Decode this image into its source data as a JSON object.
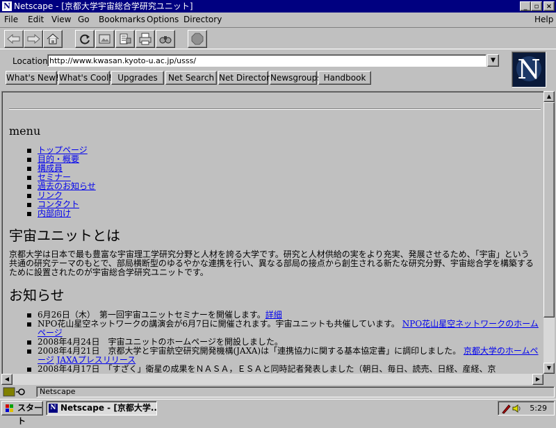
{
  "window": {
    "title": "Netscape - [京都大学宇宙総合学研究ユニット]",
    "app_icon": "N",
    "minimize": "_",
    "maximize": "▫",
    "close": "×"
  },
  "menubar": {
    "items": [
      {
        "label": "File",
        "key": "F"
      },
      {
        "label": "Edit",
        "key": "E"
      },
      {
        "label": "View",
        "key": "V"
      },
      {
        "label": "Go",
        "key": "G"
      },
      {
        "label": "Bookmarks",
        "key": "B"
      },
      {
        "label": "Options",
        "key": "O"
      },
      {
        "label": "Directory",
        "key": "D"
      }
    ],
    "help": "Help"
  },
  "toolbar": {
    "icons": [
      "back-icon",
      "forward-icon",
      "home-icon",
      "reload-icon",
      "images-icon",
      "open-icon",
      "print-icon",
      "find-icon",
      "stop-icon"
    ]
  },
  "location": {
    "label": "Location:",
    "url": "http://www.kwasan.kyoto-u.ac.jp/usss/"
  },
  "directory_buttons": [
    "What's New!",
    "What's Cool!",
    "Upgrades",
    "Net Search",
    "Net Directory",
    "Newsgroups",
    "Handbook"
  ],
  "logo": {
    "letter": "N"
  },
  "page": {
    "menu_heading": "menu",
    "menu_items": [
      "トップページ",
      "目的・概要",
      "構成員",
      "セミナー",
      "過去のお知らせ",
      "リンク",
      "コンタクト",
      "内部向け"
    ],
    "about_heading": "宇宙ユニットとは",
    "about_text": "京都大学は日本で最も豊富な宇宙理工学研究分野と人材を誇る大学です。研究と人材供給の実をより充実、発展させるため、「宇宙」という共通の研究テーマのもとで、部局横断型のゆるやかな連携を行い、異なる部局の接点から創生される新たな研究分野、宇宙総合学を構築するために設置されたのが宇宙総合学研究ユニットです。",
    "news_heading": "お知らせ",
    "news": [
      {
        "text": "6月26日（木）　第一回宇宙ユニットセミナーを開催します。",
        "links": [
          "詳細"
        ]
      },
      {
        "text": "NPO花山星空ネットワークの講演会が6月7日に開催されます。宇宙ユニットも共催しています。 ",
        "links": [
          "NPO花山星空ネットワークのホームページ"
        ]
      },
      {
        "text": "2008年4月24日　宇宙ユニットのホームページを開設しました。",
        "links": []
      },
      {
        "text": "2008年4月21日　京都大学と宇宙航空研究開発機構(JAXA)は「連携協力に関する基本協定書」に調印しました。 ",
        "links": [
          "京都大学のホームページ",
          "JAXAプレスリリース"
        ]
      },
      {
        "text": "2008年4月17日　「すざく」衛星の成果をＮＡＳＡ，ＥＳＡと同時記者発表しました（朝日、毎日、読売、日経、産経、京",
        "links": []
      }
    ]
  },
  "status": {
    "text": "Netscape"
  },
  "taskbar": {
    "start_label": "スタート",
    "task_label": "Netscape - [京都大学...",
    "clock": "5:29"
  }
}
